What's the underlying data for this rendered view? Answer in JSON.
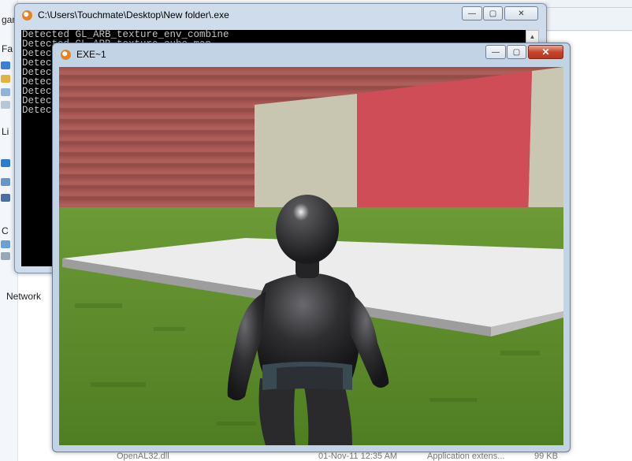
{
  "explorer": {
    "tree_fragments": [
      "gan",
      "Fa",
      "Li",
      "C"
    ],
    "network_label": "Network",
    "bottom_row": [
      "OpenAL32.dll",
      "01-Nov-11 12:35 AM",
      "Application extens...",
      "99 KB"
    ]
  },
  "console_window": {
    "title": "C:\\Users\\Touchmate\\Desktop\\New folder\\.exe",
    "lines": [
      "Detected GL_ARB_texture_env_combine",
      "Detected GL_ARB_texture_cube_map",
      "Detec",
      "Detec",
      "Detec",
      "Detec",
      "Detec",
      "Detec",
      "Detec"
    ],
    "minimize_label": "—",
    "maximize_label": "▢",
    "close_label": "✕"
  },
  "game_window": {
    "title": "EXE~1",
    "minimize_label": "—",
    "maximize_label": "▢",
    "close_label": "✕"
  },
  "colors": {
    "sky_wall": "#8b4a46",
    "red_wall": "#cf4b55",
    "beige_wall": "#c7c5b0",
    "grass": "#5f8d2a",
    "platform": "#ececec",
    "character": "#2c2c2e"
  }
}
